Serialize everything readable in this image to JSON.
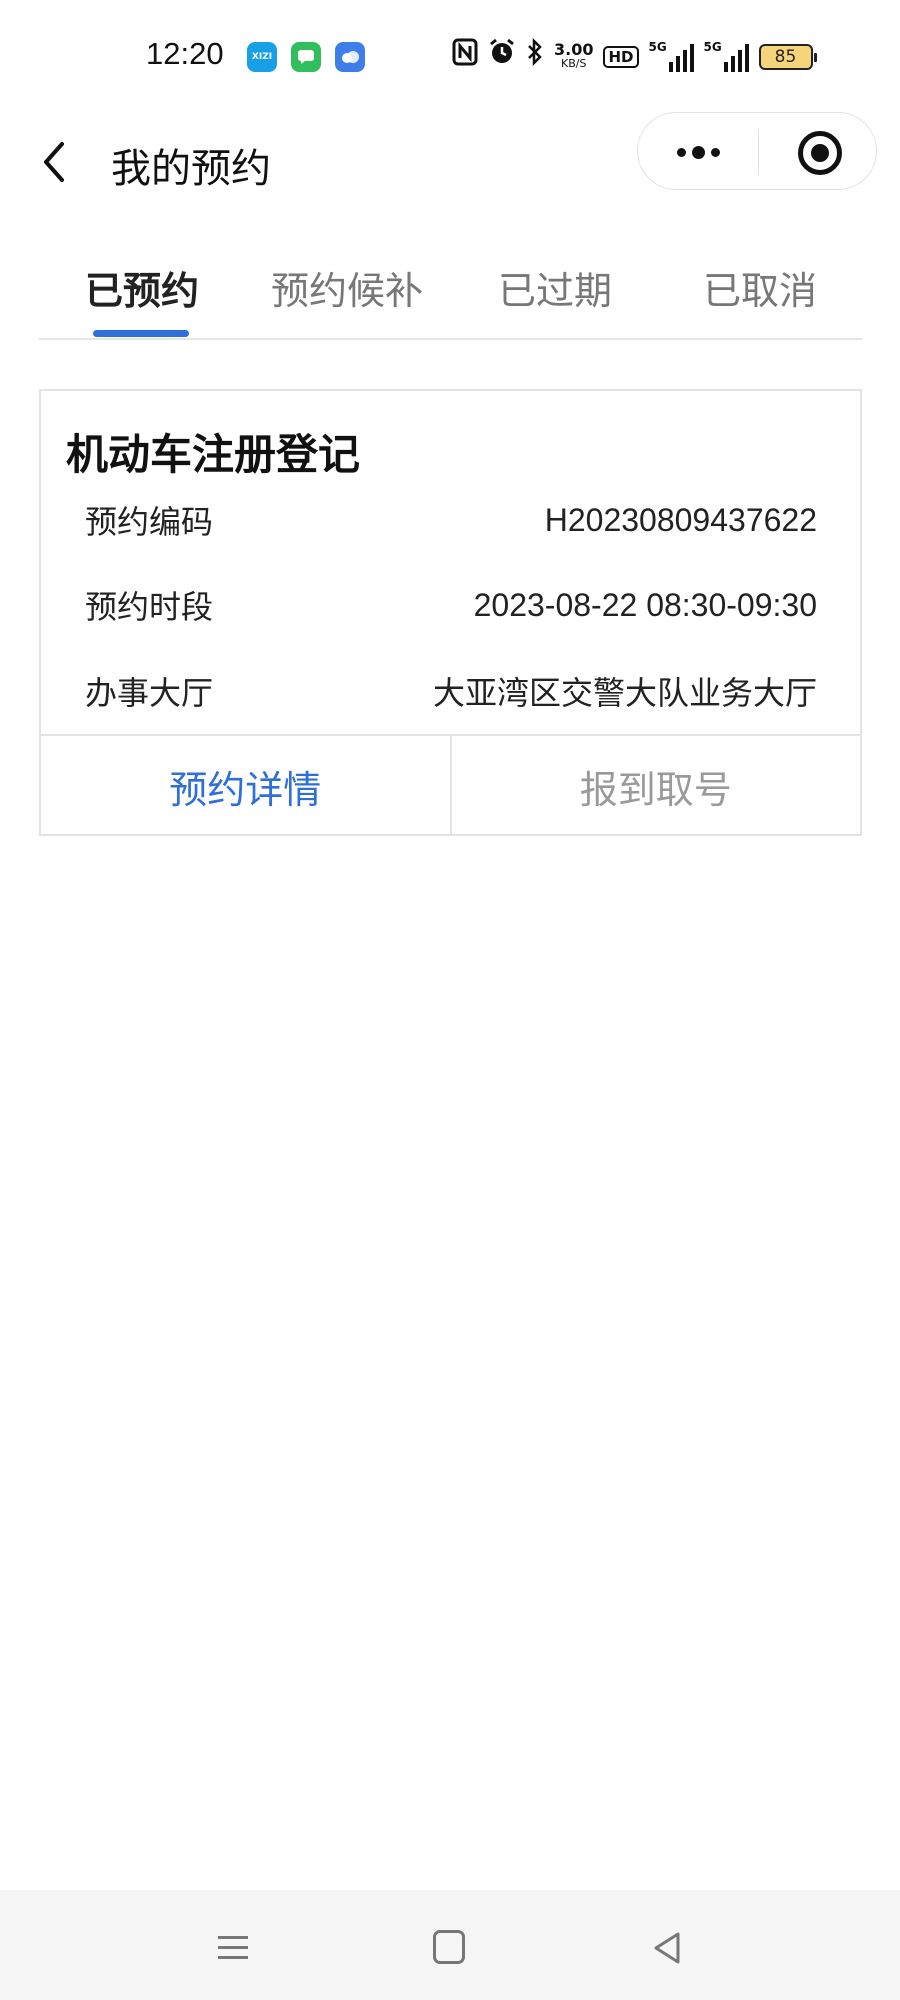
{
  "status_bar": {
    "time": "12:20",
    "notification_icons": [
      "xizi-app-icon",
      "messages-app-icon",
      "cloud-app-icon"
    ],
    "xizi_label": "XIZI",
    "net_speed_value": "3.00",
    "net_speed_unit": "KB/S",
    "hd_label": "HD",
    "signal1_label": "5G",
    "signal2_label": "5G",
    "battery_level": "85"
  },
  "header": {
    "title": "我的预约"
  },
  "tabs": [
    {
      "label": "已预约",
      "active": true
    },
    {
      "label": "预约候补",
      "active": false
    },
    {
      "label": "已过期",
      "active": false
    },
    {
      "label": "已取消",
      "active": false
    }
  ],
  "appointment": {
    "title": "机动车注册登记",
    "fields": [
      {
        "label": "预约编码",
        "value": "H20230809437622"
      },
      {
        "label": "预约时段",
        "value": "2023-08-22 08:30-09:30"
      },
      {
        "label": "办事大厅",
        "value": "大亚湾区交警大队业务大厅"
      }
    ],
    "actions": {
      "detail": "预约详情",
      "checkin": "报到取号"
    }
  },
  "colors": {
    "accent": "#2f6fd8",
    "disabled": "#9a9a9a",
    "battery": "#f5d47a"
  }
}
